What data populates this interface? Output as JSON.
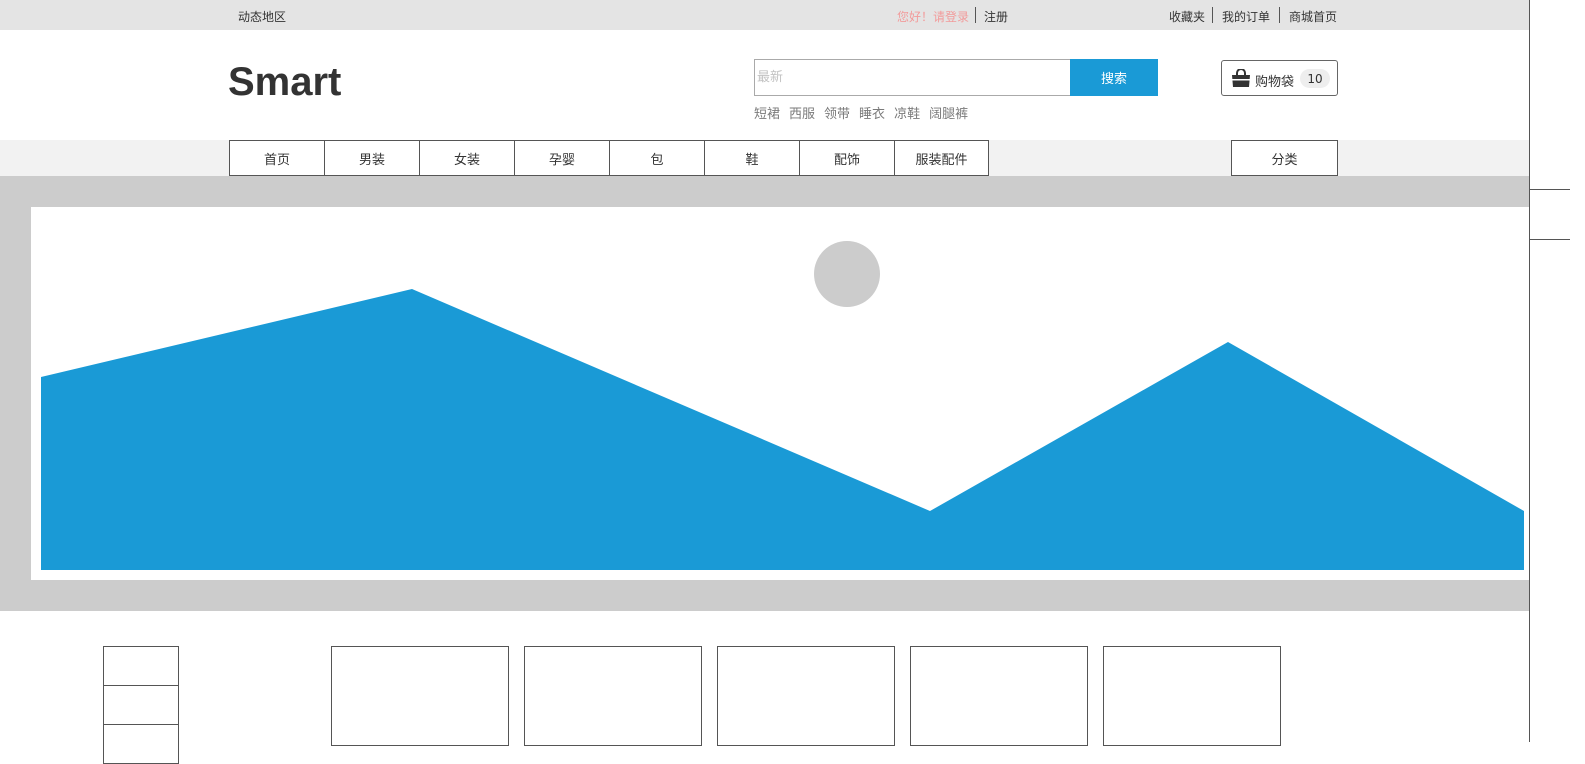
{
  "topbar": {
    "region": "动态地区",
    "greeting": "您好！请登录",
    "register": "注册",
    "links": [
      "收藏夹",
      "我的订单",
      "商城首页"
    ]
  },
  "header": {
    "logo": "Smart",
    "search": {
      "placeholder": "最新",
      "button_label": "搜索"
    },
    "hot_words": [
      "短裙",
      "西服",
      "领带",
      "睡衣",
      "凉鞋",
      "阔腿裤"
    ],
    "cart": {
      "icon": "shopping-bag-icon",
      "label": "购物袋",
      "count": "10"
    }
  },
  "nav": {
    "items": [
      "首页",
      "男装",
      "女装",
      "孕婴",
      "包",
      "鞋",
      "配饰",
      "服装配件"
    ],
    "category": "分类"
  },
  "colors": {
    "accent": "#1a9ad6",
    "greeting": "#f29b9b",
    "banner_bg": "#cccccc",
    "topbar_bg": "#e4e4e4"
  }
}
